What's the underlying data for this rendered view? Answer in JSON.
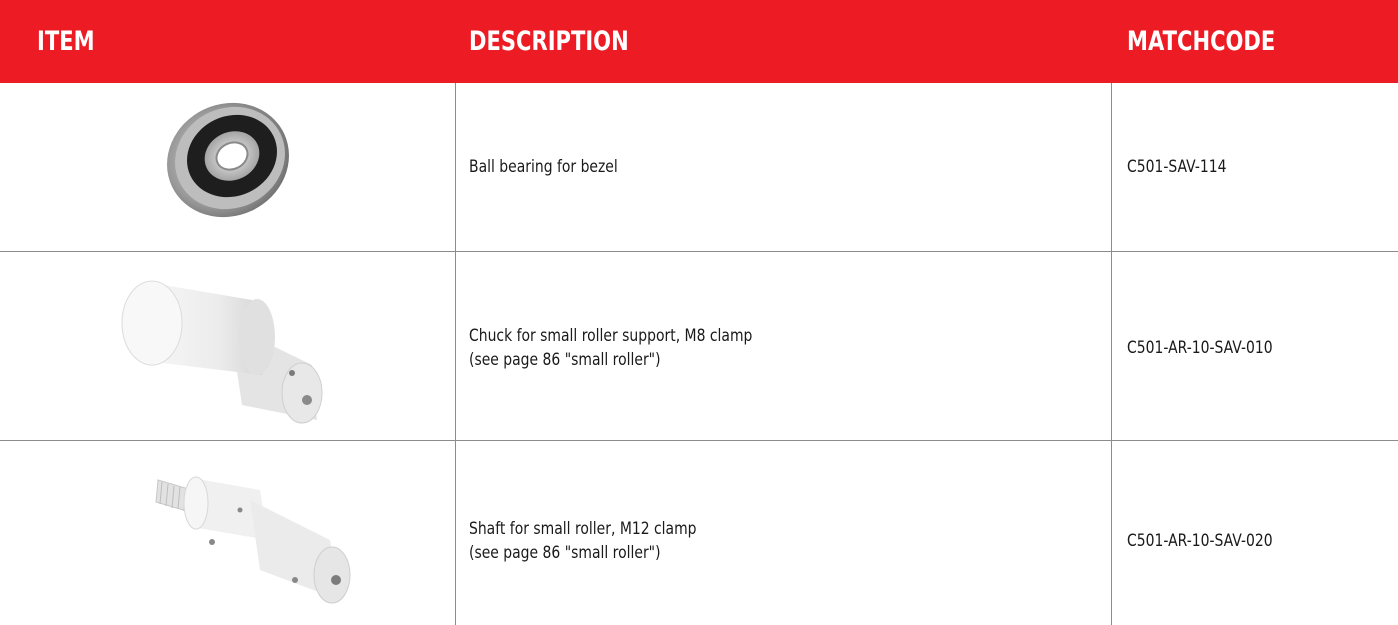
{
  "header": {
    "item": "ITEM",
    "description": "DESCRIPTION",
    "matchcode": "MATCHCODE"
  },
  "rows": [
    {
      "image": "ball-bearing-icon",
      "description_line1": "Ball bearing for bezel",
      "description_line2": "",
      "matchcode": "C501-SAV-114"
    },
    {
      "image": "chuck-icon",
      "description_line1": "Chuck for small roller support, M8 clamp",
      "description_line2": "(see page 86 \"small roller\")",
      "matchcode": "C501-AR-10-SAV-010"
    },
    {
      "image": "shaft-icon",
      "description_line1": "Shaft for small roller, M12 clamp",
      "description_line2": "(see page 86 \"small roller\")",
      "matchcode": "C501-AR-10-SAV-020"
    }
  ],
  "colors": {
    "header_bg": "#ed1c24",
    "header_text": "#ffffff",
    "grid": "#8c8c8c"
  }
}
